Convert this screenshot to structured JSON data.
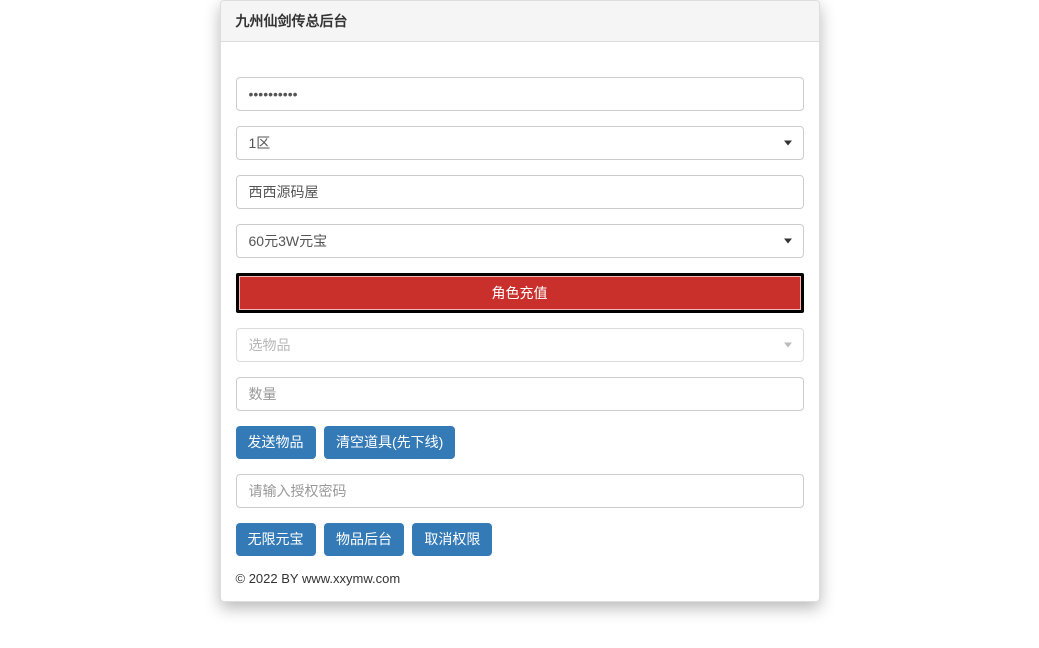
{
  "panel": {
    "title": "九州仙剑传总后台"
  },
  "form": {
    "password_value": "helloworld",
    "region_value": "1区",
    "char_name_value": "西西源码屋",
    "package_value": "60元3W元宝",
    "recharge_button": "角色充值",
    "item_select_placeholder": "选物品",
    "quantity_placeholder": "数量",
    "send_item_button": "发送物品",
    "clear_items_button": "清空道具(先下线)",
    "auth_password_placeholder": "请输入授权密码",
    "unlimited_yuanbao_button": "无限元宝",
    "item_backend_button": "物品后台",
    "cancel_perm_button": "取消权限"
  },
  "footer": {
    "text": "© 2022 BY www.xxymw.com"
  }
}
